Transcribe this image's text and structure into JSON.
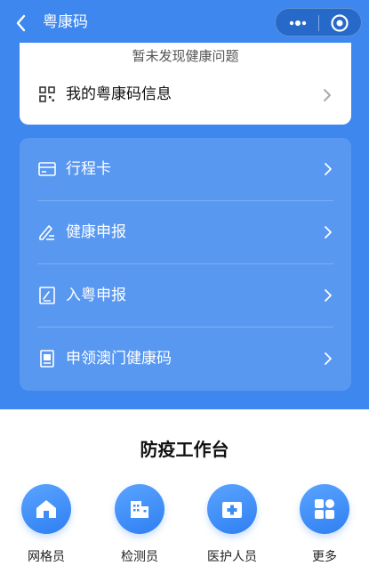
{
  "header": {
    "title": "粤康码",
    "back_icon": "chevron-left-icon",
    "more_icon": "more-dots-icon",
    "close_icon": "target-close-icon"
  },
  "health_card": {
    "status_text": "暂未发现健康问题",
    "info_label": "我的粤康码信息",
    "info_icon": "qr-code-icon"
  },
  "menu": {
    "items": [
      {
        "label": "行程卡",
        "icon": "card-icon"
      },
      {
        "label": "健康申报",
        "icon": "edit-icon"
      },
      {
        "label": "入粤申报",
        "icon": "document-edit-icon"
      },
      {
        "label": "申领澳门健康码",
        "icon": "form-icon"
      }
    ]
  },
  "workbench": {
    "title": "防疫工作台",
    "tools": [
      {
        "label": "网格员",
        "icon": "home-icon"
      },
      {
        "label": "检测员",
        "icon": "building-icon"
      },
      {
        "label": "医护人员",
        "icon": "medical-kit-icon"
      },
      {
        "label": "更多",
        "icon": "grid-apps-icon"
      }
    ]
  },
  "colors": {
    "primary_blue": "#3d87ef",
    "circle_blue": "#3c8df5",
    "white": "#ffffff"
  }
}
